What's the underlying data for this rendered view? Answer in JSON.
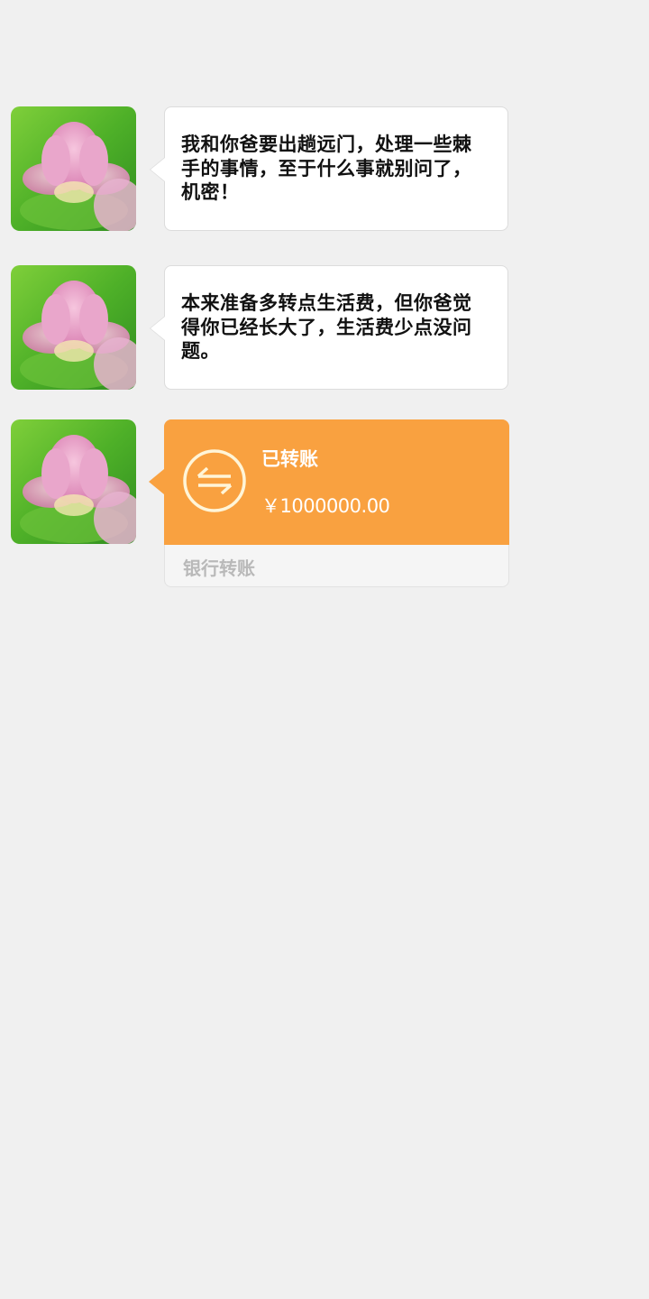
{
  "messages": [
    {
      "text": "我和你爸要出趟远门，处理一些棘手的事情，至于什么事就别问了，机密！"
    },
    {
      "text": "本来准备多转点生活费，但你爸觉得你已经长大了，生活费少点没问题。"
    }
  ],
  "transfer": {
    "status": "已转账",
    "amount": "￥1000000.00",
    "bank_label": "银行转账",
    "icon": "transfer-arrows-icon"
  },
  "colors": {
    "background": "#f0f0f0",
    "transfer_orange": "#f9a140",
    "bubble_white": "#ffffff",
    "muted_text": "#b9b9b9"
  },
  "avatar": {
    "icon": "lotus-flower-avatar"
  }
}
